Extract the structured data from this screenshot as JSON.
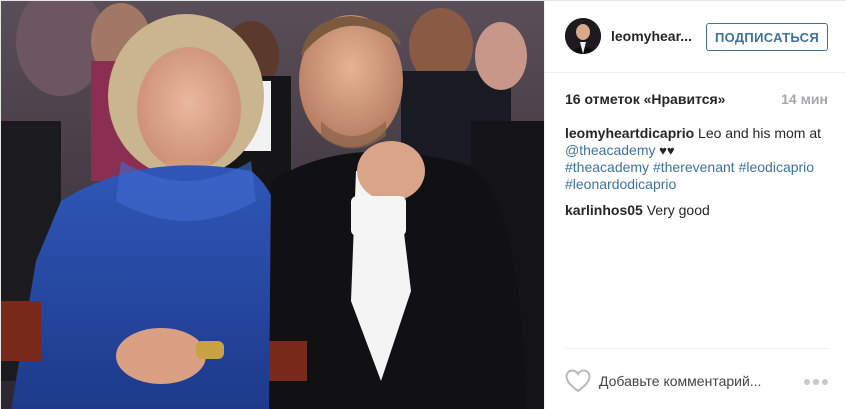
{
  "header": {
    "username": "leomyhear...",
    "follow_label": "ПОДПИСАТЬСЯ"
  },
  "meta": {
    "likes": "16 отметок «Нравится»",
    "time": "14 мин"
  },
  "caption": {
    "user": "leomyheartdicaprio",
    "text": " Leo and his mom at ",
    "mention": "@theacademy",
    "hearts": " ♥♥",
    "hashtags": [
      "#theacademy",
      "#therevenant",
      "#leodicaprio",
      "#leonardodicaprio"
    ]
  },
  "comments": [
    {
      "user": "karlinhos05",
      "text": " Very good"
    }
  ],
  "footer": {
    "comment_placeholder": "Добавьте комментарий..."
  },
  "icons": {
    "like": "heart-outline-icon",
    "more": "ellipsis-icon"
  },
  "colors": {
    "link": "#3f729b",
    "muted": "#a5a7aa",
    "text": "#262626"
  }
}
